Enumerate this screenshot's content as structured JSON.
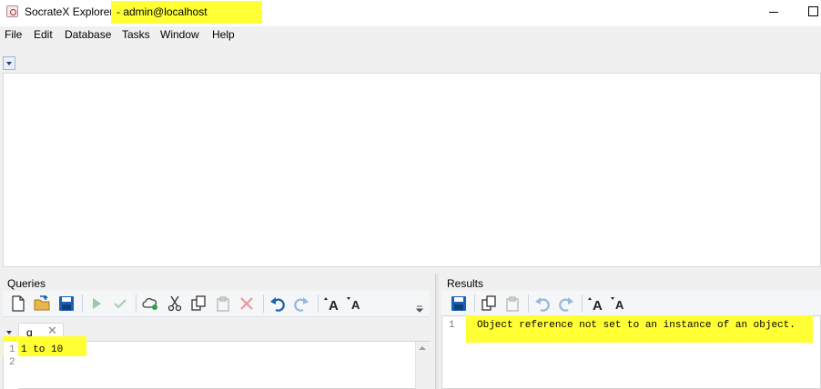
{
  "window": {
    "app_title": "SocrateX Explorer",
    "user": "- admin@localhost"
  },
  "menu": [
    "File",
    "Edit",
    "Database",
    "Tasks",
    "Window",
    "Help"
  ],
  "queries": {
    "label": "Queries",
    "toolbar_icons": [
      "new-file-icon",
      "open-file-icon",
      "save-icon",
      "run-icon",
      "check-icon",
      "cloud-icon",
      "cut-icon",
      "copy-icon",
      "paste-icon",
      "delete-icon",
      "undo-icon",
      "redo-icon",
      "font-increase-icon",
      "font-decrease-icon"
    ],
    "tab": {
      "label": "q",
      "close": "✕"
    },
    "lines": [
      {
        "num": "1",
        "text": "1 to 10"
      },
      {
        "num": "2",
        "text": ""
      }
    ]
  },
  "results": {
    "label": "Results",
    "toolbar_icons": [
      "save-icon",
      "copy-icon",
      "paste-icon",
      "undo-icon",
      "redo-icon",
      "font-increase-icon",
      "font-decrease-icon"
    ],
    "lines": [
      {
        "num": "1",
        "text": "Object reference not set to an instance of an object."
      }
    ]
  },
  "colors": {
    "highlight": "#ffff33",
    "accent_blue": "#1a5fb4"
  }
}
